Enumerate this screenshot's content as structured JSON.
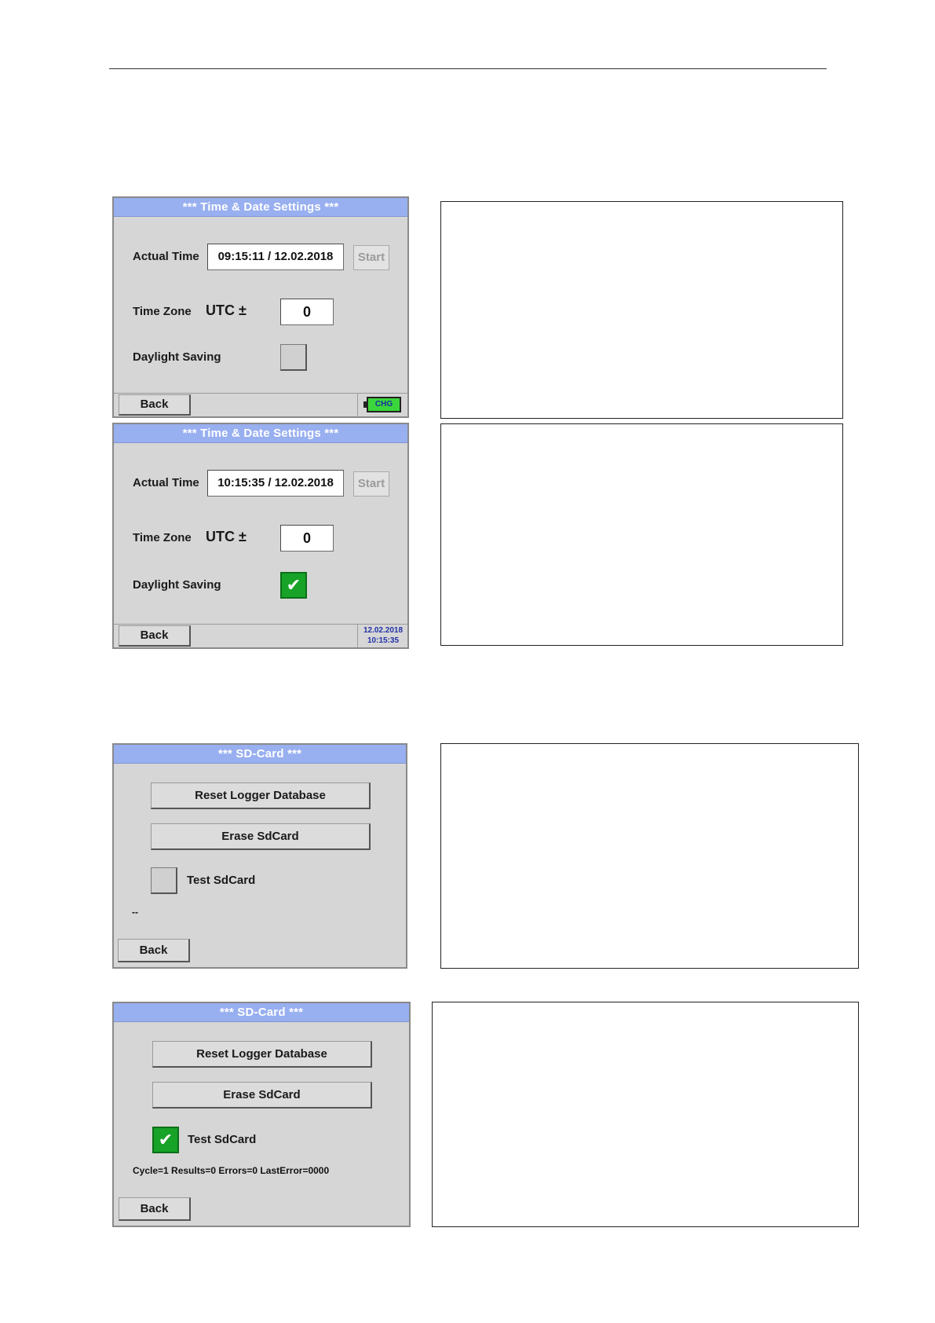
{
  "screens": {
    "time1": {
      "title": "***  Time & Date Settings  ***",
      "actual_time_label": "Actual Time",
      "actual_time_value": "09:15:11 / 12.02.2018",
      "start_label": "Start",
      "time_zone_label": "Time Zone",
      "utc_label": "UTC ±",
      "time_zone_value": "0",
      "daylight_label": "Daylight Saving",
      "daylight_checked": false,
      "back_label": "Back",
      "battery_label": "CHG",
      "battery_color": "#3bd63b"
    },
    "time2": {
      "title": "***  Time & Date Settings  ***",
      "actual_time_label": "Actual Time",
      "actual_time_value": "10:15:35 / 12.02.2018",
      "start_label": "Start",
      "time_zone_label": "Time Zone",
      "utc_label": "UTC ±",
      "time_zone_value": "0",
      "daylight_label": "Daylight Saving",
      "daylight_checked": true,
      "check_mark": "✔",
      "back_label": "Back",
      "status_date": "12.02.2018",
      "status_time": "10:15:35"
    },
    "sd1": {
      "title": "***  SD-Card  ***",
      "reset_label": "Reset Logger Database",
      "erase_label": "Erase SdCard",
      "test_label": "Test SdCard",
      "test_checked": false,
      "status_text": "--",
      "back_label": "Back"
    },
    "sd2": {
      "title": "***  SD-Card  ***",
      "reset_label": "Reset Logger Database",
      "erase_label": "Erase SdCard",
      "test_label": "Test SdCard",
      "test_checked": true,
      "check_mark": "✔",
      "status_text": "Cycle=1 Results=0 Errors=0 LastError=0000",
      "back_label": "Back"
    }
  },
  "colors": {
    "title_bar": "#98aff0",
    "screen_bg": "#d6d6d6",
    "checkbox_on": "#17a328",
    "status_clock": "#2030a8"
  }
}
